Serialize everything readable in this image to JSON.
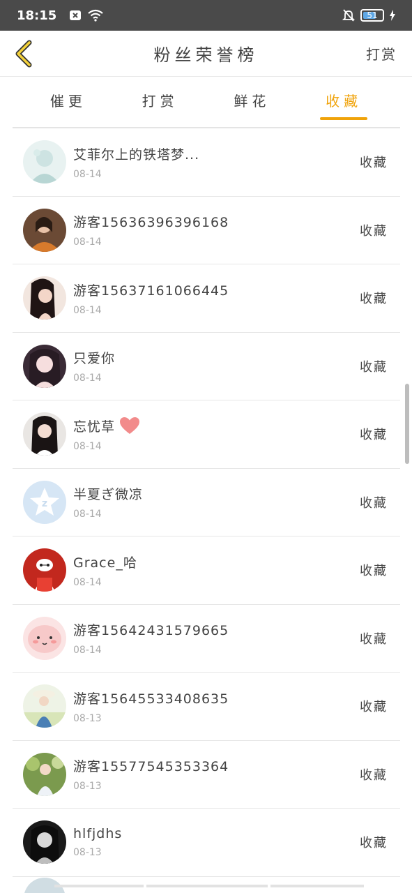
{
  "status_bar": {
    "time": "18:15",
    "battery": "51",
    "icons": [
      "close-box-icon",
      "wifi-icon",
      "mute-bell-icon",
      "charging-icon"
    ]
  },
  "nav": {
    "title": "粉丝荣誉榜",
    "right_action": "打赏"
  },
  "tabs": [
    {
      "label": "催更",
      "active": false
    },
    {
      "label": "打赏",
      "active": false
    },
    {
      "label": "鲜花",
      "active": false
    },
    {
      "label": "收藏",
      "active": true
    }
  ],
  "rows": [
    {
      "name": "艾菲尔上的铁塔梦...",
      "date": "08-14",
      "action": "收藏"
    },
    {
      "name": "游客15636396396168",
      "date": "08-14",
      "action": "收藏"
    },
    {
      "name": "游客15637161066445",
      "date": "08-14",
      "action": "收藏"
    },
    {
      "name": "只爱你",
      "date": "08-14",
      "action": "收藏"
    },
    {
      "name": "忘忧草",
      "date": "08-14",
      "action": "收藏"
    },
    {
      "name": "半夏ぎ微凉",
      "date": "08-14",
      "action": "收藏"
    },
    {
      "name": "Grace_哈",
      "date": "08-14",
      "action": "收藏"
    },
    {
      "name": "游客15642431579665",
      "date": "08-14",
      "action": "收藏"
    },
    {
      "name": "游客15645533408635",
      "date": "08-13",
      "action": "收藏"
    },
    {
      "name": "游客15577545353364",
      "date": "08-13",
      "action": "收藏"
    },
    {
      "name": "hlfjdhs",
      "date": "08-13",
      "action": "收藏"
    }
  ],
  "colors": {
    "accent": "#f0a30a",
    "status_bar": "#4a4a4a",
    "divider": "#e6e6e6"
  }
}
